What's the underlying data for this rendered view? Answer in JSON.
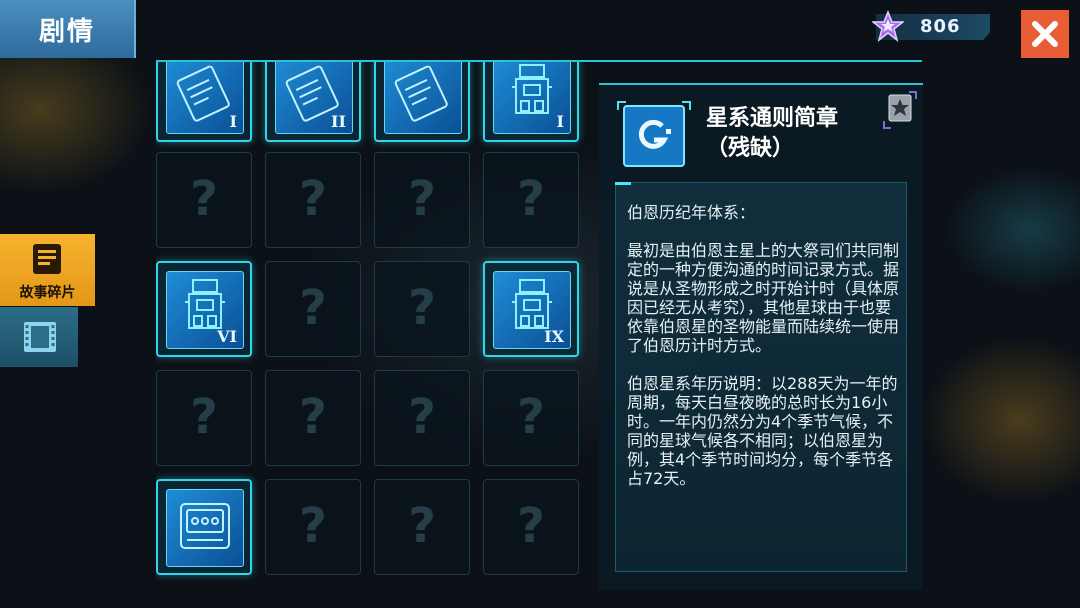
{
  "header": {
    "title": "剧情",
    "close_icon": "close-icon"
  },
  "currency": {
    "icon": "purple-star-icon",
    "value": "806"
  },
  "side_tabs": [
    {
      "label": "故事碎片",
      "icon": "document-icon",
      "active": true
    },
    {
      "label": "",
      "icon": "film-icon",
      "active": false
    }
  ],
  "grid": {
    "unknown_symbol": "?",
    "rows": [
      [
        "I",
        "II",
        "",
        "I"
      ],
      [
        "",
        "",
        "",
        ""
      ],
      [
        "VI",
        "",
        "",
        "IX"
      ],
      [
        "",
        "",
        "",
        ""
      ],
      [
        "",
        "",
        "",
        ""
      ]
    ]
  },
  "detail": {
    "title": "星系通则简章（残缺）",
    "paragraphs": [
      "伯恩历纪年体系：",
      "最初是由伯恩主星上的大祭司们共同制定的一种方便沟通的时间记录方式。据说是从圣物形成之时开始计时（具体原因已经无从考究），其他星球由于也要依靠伯恩星的圣物能量而陆续统一使用了伯恩历计时方式。",
      "伯恩星系年历说明：以288天为一年的周期，每天白昼夜晚的总时长为16小时。一年内仍然分为4个季节气候，不同的星球气候各不相同；以伯恩星为例，其4个季节时间均分，每个季节各占72天。"
    ]
  },
  "colors": {
    "accent": "#27c3d8",
    "close": "#e85c36",
    "active_tab": "#f7b32e"
  }
}
